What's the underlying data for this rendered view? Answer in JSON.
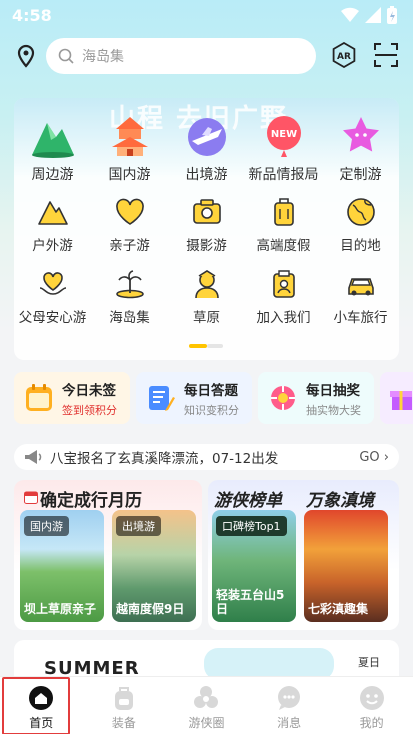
{
  "status": {
    "time": "4:58"
  },
  "search": {
    "placeholder": "海岛集"
  },
  "banner": {
    "ghost_text": "山程 去旧广野"
  },
  "main_menu": [
    {
      "label": "周边游",
      "icon": "mountain-icon"
    },
    {
      "label": "国内游",
      "icon": "pagoda-icon"
    },
    {
      "label": "出境游",
      "icon": "plane-icon"
    },
    {
      "label": "新品情报局",
      "icon": "new-balloon-icon",
      "badge": "NEW"
    },
    {
      "label": "定制游",
      "icon": "star-icon"
    }
  ],
  "sub_menu_row1": [
    {
      "label": "户外游",
      "icon": "outdoor-mountain-icon"
    },
    {
      "label": "亲子游",
      "icon": "heart-icon"
    },
    {
      "label": "摄影游",
      "icon": "camera-icon"
    },
    {
      "label": "高端度假",
      "icon": "luggage-icon"
    },
    {
      "label": "目的地",
      "icon": "globe-icon"
    }
  ],
  "sub_menu_row2": [
    {
      "label": "父母安心游",
      "icon": "care-heart-icon"
    },
    {
      "label": "海岛集",
      "icon": "island-icon"
    },
    {
      "label": "草原",
      "icon": "grassland-person-icon"
    },
    {
      "label": "加入我们",
      "icon": "join-badge-icon"
    },
    {
      "label": "小车旅行",
      "icon": "car-icon"
    }
  ],
  "quick_entries": [
    {
      "title": "今日未签",
      "sub": "签到领积分",
      "icon": "calendar-icon"
    },
    {
      "title": "每日答题",
      "sub": "知识变积分",
      "icon": "pencil-icon"
    },
    {
      "title": "每日抽奖",
      "sub": "抽实物大奖",
      "icon": "lottery-icon"
    }
  ],
  "notice": {
    "text": "八宝报名了玄真溪降漂流，07-12出发",
    "go": "GO"
  },
  "panel_left": {
    "title": "确定成行月历",
    "items": [
      {
        "tag": "国内游",
        "caption": "坝上草原亲子"
      },
      {
        "tag": "出境游",
        "caption": "越南度假9日"
      }
    ]
  },
  "panel_right": {
    "title1": "游侠榜单",
    "title2": "万象滇境",
    "items": [
      {
        "tag": "口碑榜Top1",
        "caption": "轻装五台山5日"
      },
      {
        "caption": "七彩滇趣集"
      }
    ]
  },
  "summer": {
    "text": "SUMMER",
    "right_text": "夏日"
  },
  "tabs": [
    {
      "label": "首页",
      "icon": "home-icon"
    },
    {
      "label": "装备",
      "icon": "backpack-icon"
    },
    {
      "label": "游侠圈",
      "icon": "circle-flower-icon"
    },
    {
      "label": "消息",
      "icon": "chat-bubble-icon"
    },
    {
      "label": "我的",
      "icon": "smiley-face-icon"
    }
  ]
}
